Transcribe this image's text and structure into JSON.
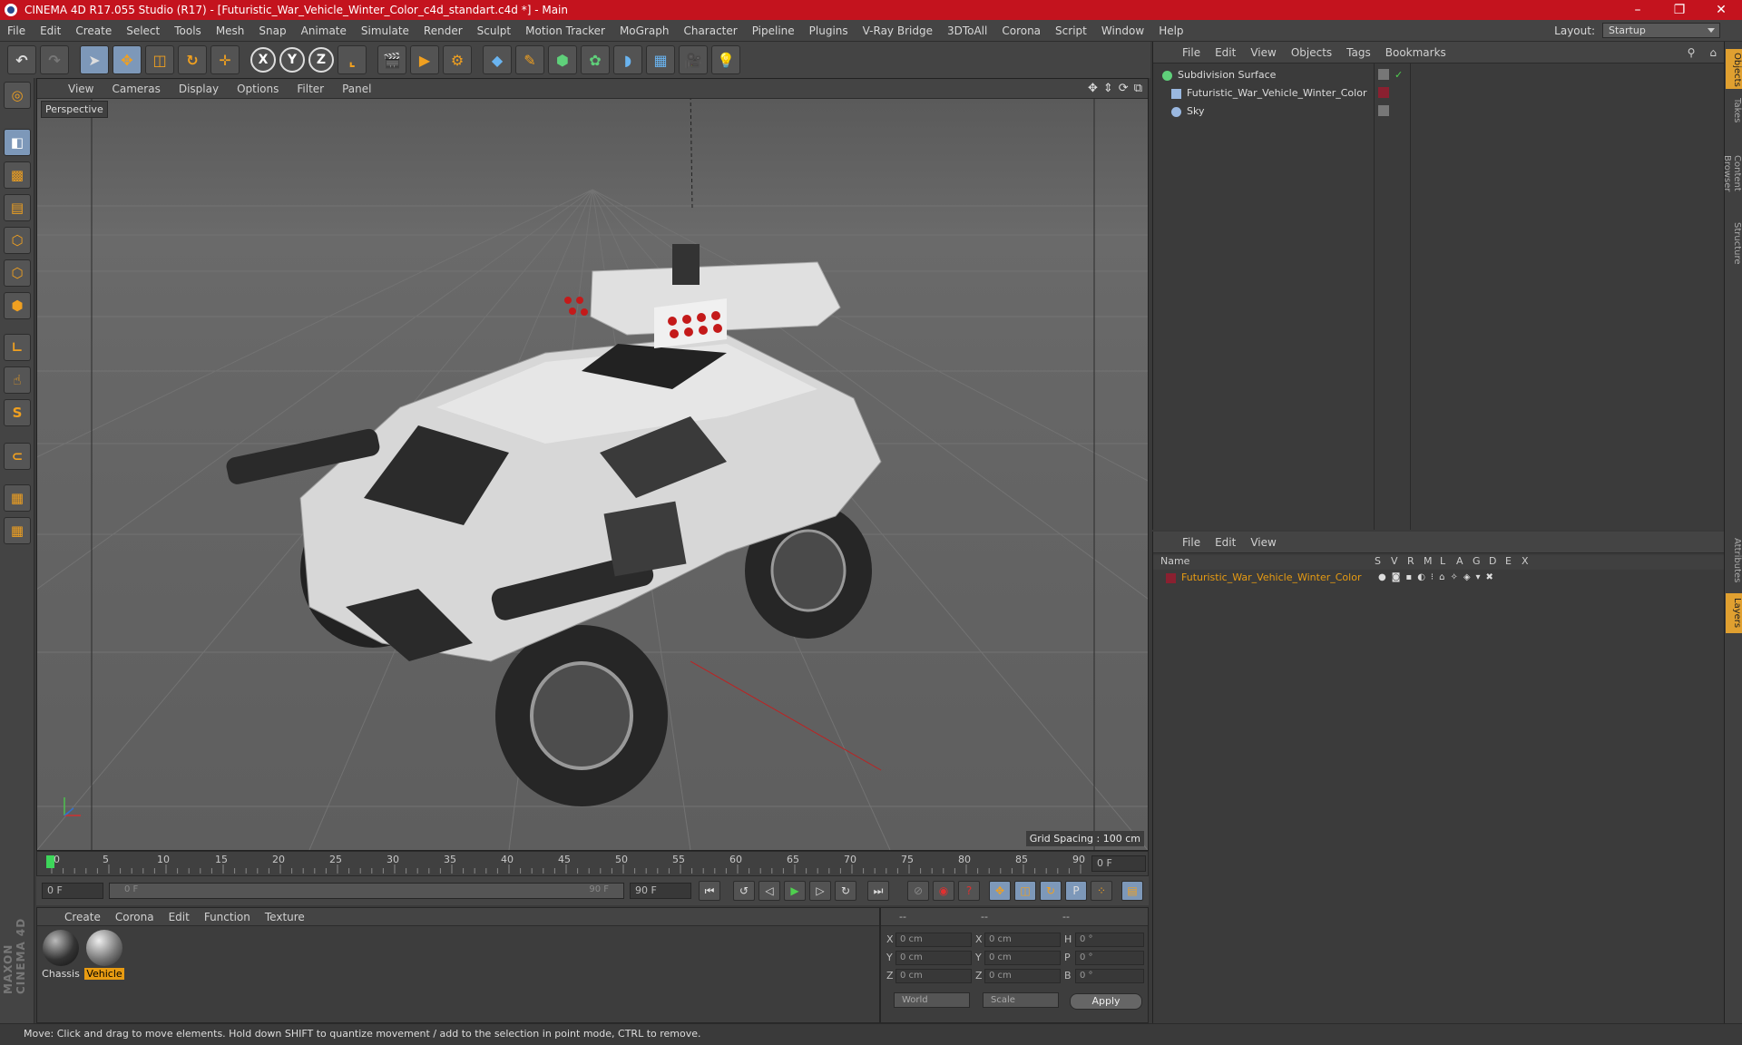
{
  "window": {
    "title": "CINEMA 4D R17.055 Studio (R17) - [Futuristic_War_Vehicle_Winter_Color_c4d_standart.c4d *] - Main",
    "minimize": "–",
    "restore": "❐",
    "close": "✕"
  },
  "menu": {
    "items": [
      "File",
      "Edit",
      "Create",
      "Select",
      "Tools",
      "Mesh",
      "Snap",
      "Animate",
      "Simulate",
      "Render",
      "Sculpt",
      "Motion Tracker",
      "MoGraph",
      "Character",
      "Pipeline",
      "Plugins",
      "V-Ray Bridge",
      "3DToAll",
      "Corona",
      "Script",
      "Window",
      "Help"
    ],
    "layout_label": "Layout:",
    "layout_value": "Startup"
  },
  "viewport": {
    "menu": [
      "View",
      "Cameras",
      "Display",
      "Options",
      "Filter",
      "Panel"
    ],
    "camera_label": "Perspective",
    "grid_spacing": "Grid Spacing : 100 cm"
  },
  "timeline": {
    "ticks": [
      "0",
      "5",
      "10",
      "15",
      "20",
      "25",
      "30",
      "35",
      "40",
      "45",
      "50",
      "55",
      "60",
      "65",
      "70",
      "75",
      "80",
      "85",
      "90"
    ],
    "current_frame": "0 F",
    "start_field": "0 F",
    "range_start": "0 F",
    "range_end": "90 F",
    "end_field": "90 F"
  },
  "materials": {
    "menu": [
      "Create",
      "Corona",
      "Edit",
      "Function",
      "Texture"
    ],
    "items": [
      {
        "name": "Chassis"
      },
      {
        "name": "Vehicle"
      }
    ]
  },
  "coordinates": {
    "headers": [
      "--",
      "--",
      "--"
    ],
    "rows": [
      {
        "axis": "X",
        "pos": "0 cm",
        "axis2": "X",
        "size": "0 cm",
        "rot_label": "H",
        "rot": "0 °"
      },
      {
        "axis": "Y",
        "pos": "0 cm",
        "axis2": "Y",
        "size": "0 cm",
        "rot_label": "P",
        "rot": "0 °"
      },
      {
        "axis": "Z",
        "pos": "0 cm",
        "axis2": "Z",
        "size": "0 cm",
        "rot_label": "B",
        "rot": "0 °"
      }
    ],
    "space": "World",
    "mode": "Scale",
    "apply": "Apply"
  },
  "objects": {
    "menu": [
      "File",
      "Edit",
      "View",
      "Objects",
      "Tags",
      "Bookmarks"
    ],
    "items": [
      {
        "name": "Subdivision Surface",
        "color": "#5fd07a"
      },
      {
        "name": "Futuristic_War_Vehicle_Winter_Color",
        "color": "#9ab8e0"
      },
      {
        "name": "Sky",
        "color": "#9ab8e0"
      }
    ]
  },
  "layers": {
    "menu": [
      "File",
      "Edit",
      "View"
    ],
    "columns": [
      "Name",
      "S",
      "V",
      "R",
      "M",
      "L",
      "A",
      "G",
      "D",
      "E",
      "X"
    ],
    "items": [
      {
        "name": "Futuristic_War_Vehicle_Winter_Color",
        "color": "#8a2030"
      }
    ]
  },
  "right_tabs": [
    "Objects",
    "Takes",
    "Content Browser",
    "Structure",
    "Attributes",
    "Layers"
  ],
  "status": "Move: Click and drag to move elements. Hold down SHIFT to quantize movement / add to the selection in point mode, CTRL to remove.",
  "brand": "MAXON CINEMA 4D"
}
